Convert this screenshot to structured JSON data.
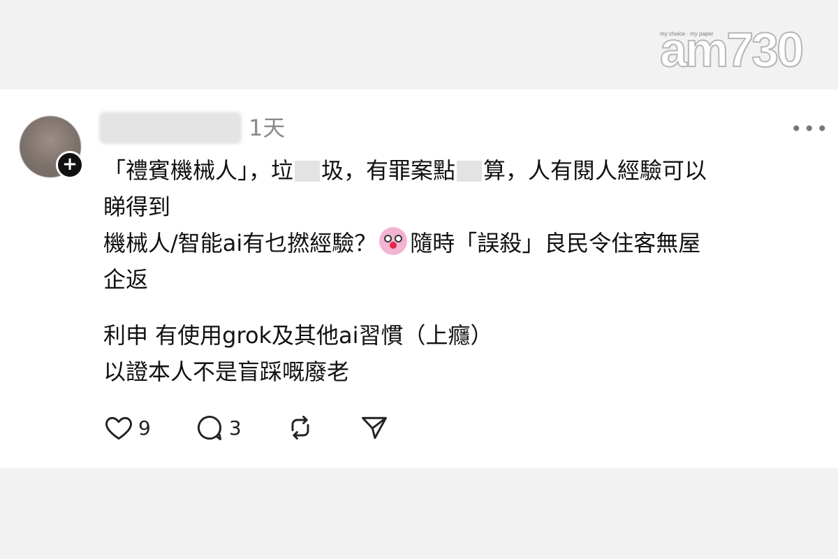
{
  "logo": {
    "tagline": "my choice · my paper",
    "text": "am730"
  },
  "post": {
    "timestamp": "1天",
    "more_label": "•••",
    "lines": {
      "l1_a": "「禮賓機械人」，垃",
      "l1_b": "圾，有罪案點",
      "l1_c": "算，人有閱人經驗可以",
      "l2": "睇得到",
      "l3_a": "機械人/智能ai有乜撚經驗？",
      "l3_b": "隨時「誤殺」良民令住客無屋",
      "l4": "企返",
      "l5": "利申 有使用grok及其他ai習慣（上癮）",
      "l6": "以證本人不是盲踩嘅廢老"
    },
    "emoji": "clown-face",
    "actions": {
      "likes": "9",
      "comments": "3"
    }
  },
  "icons": {
    "follow": "plus-icon",
    "like": "heart-icon",
    "comment": "comment-bubble-icon",
    "repost": "repost-icon",
    "share": "send-icon",
    "more": "more-dots-icon"
  }
}
